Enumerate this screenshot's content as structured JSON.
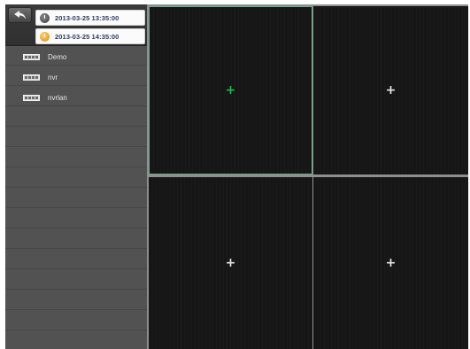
{
  "sidebar": {
    "back_icon": "back-arrow-icon",
    "start_time": "2013-03-25 13:35:00",
    "end_time": "2013-03-25 14:35:00",
    "devices": [
      {
        "label": "Demo",
        "icon": "device-icon"
      },
      {
        "label": "nvr",
        "icon": "device-icon"
      },
      {
        "label": "nvrlan",
        "icon": "device-icon"
      }
    ]
  },
  "grid": {
    "cells": [
      {
        "icon": "add-channel-icon",
        "selected": true
      },
      {
        "icon": "add-channel-icon",
        "selected": false
      },
      {
        "icon": "add-channel-icon",
        "selected": false
      },
      {
        "icon": "add-channel-icon",
        "selected": false
      }
    ],
    "plus_glyph": "+"
  },
  "colors": {
    "selected_plus": "#18b84a",
    "selected_border": "#5fae88",
    "time_text": "#2e3a60"
  }
}
